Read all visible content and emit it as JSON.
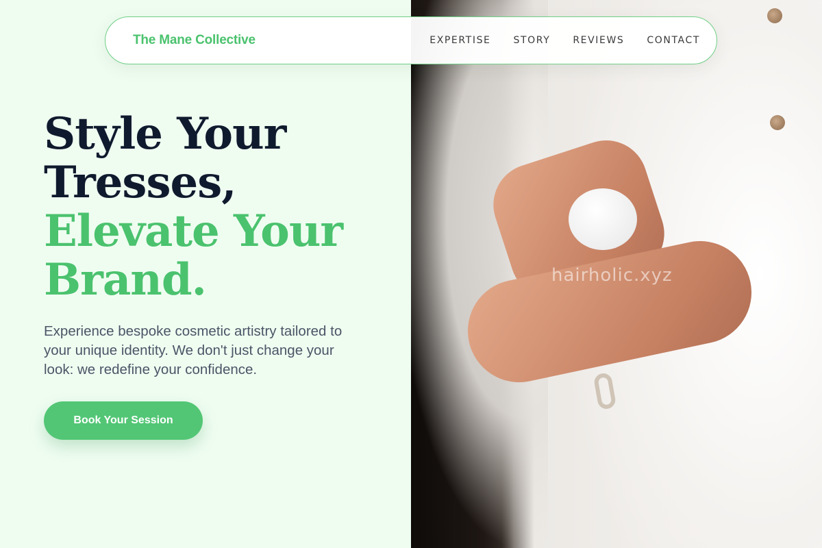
{
  "nav": {
    "brand": "The Mane Collective",
    "links": [
      "EXPERTISE",
      "STORY",
      "REVIEWS",
      "CONTACT"
    ]
  },
  "hero": {
    "headline_dark_1": "Style Your",
    "headline_dark_2": "Tresses,",
    "headline_green_1": "Elevate Your",
    "headline_green_2": "Brand.",
    "lead": "Experience bespoke cosmetic artistry tailored to your unique identity. We don't just change your look: we redefine your confidence.",
    "cta_label": "Book Your Session"
  },
  "image": {
    "watermark": "hairholic.xyz"
  },
  "colors": {
    "accent": "#4bc26e",
    "headline_dark": "#101a2e",
    "background": "#effdf1"
  }
}
